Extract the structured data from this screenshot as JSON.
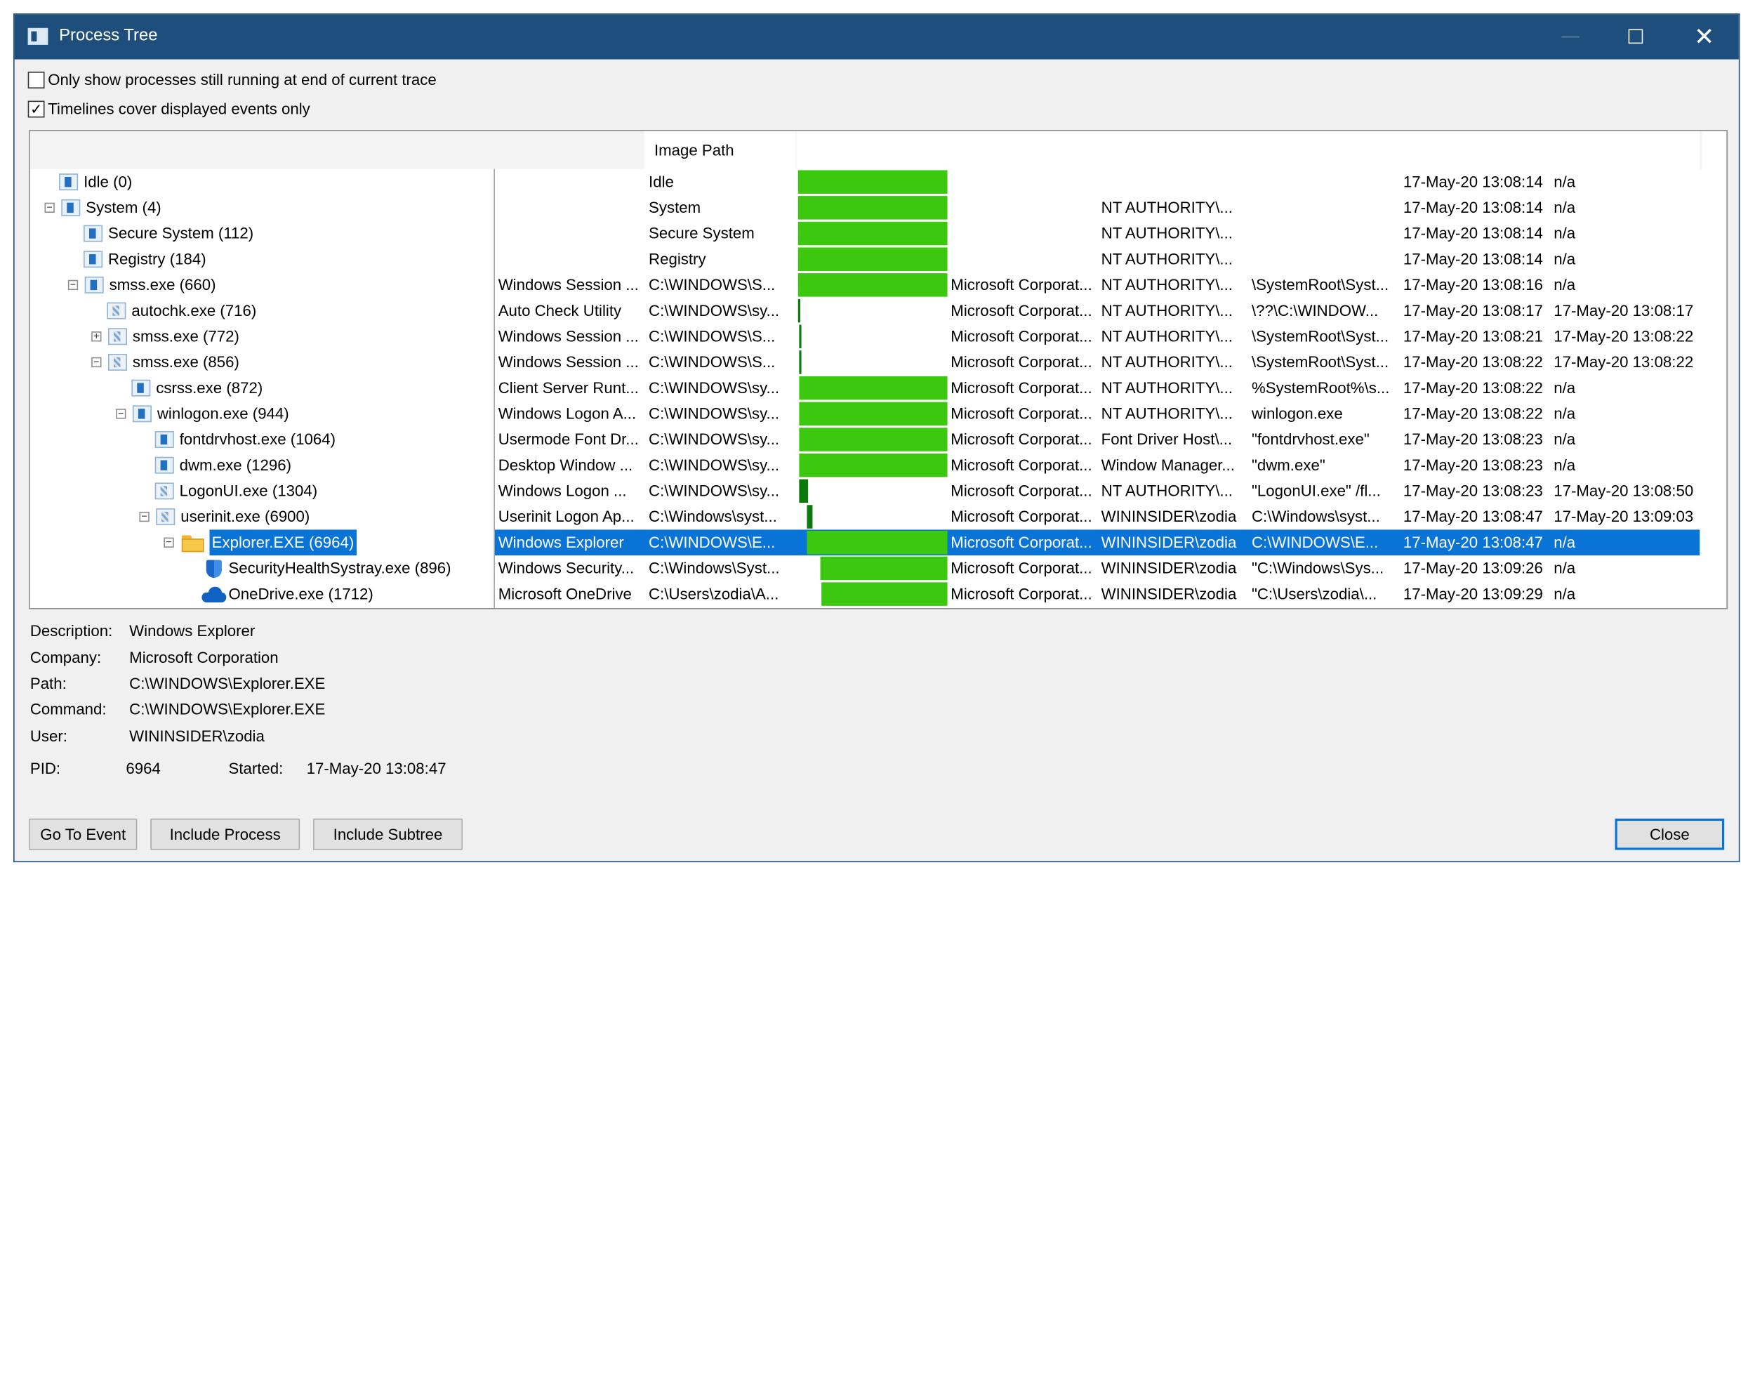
{
  "window": {
    "title": "Process Tree",
    "controls": {
      "minimize": "—",
      "close": "✕"
    }
  },
  "options": {
    "running_only": {
      "label": "Only show processes still running at end of current trace",
      "checked": false
    },
    "timelines_displayed_only": {
      "label": "Timelines cover displayed events only",
      "checked": true
    }
  },
  "columns": {
    "image_path": "Image Path"
  },
  "rows": [
    {
      "name": "Idle (0)",
      "desc": "",
      "path": "Idle",
      "company": "",
      "user": "",
      "cmd": "",
      "start": "17-May-20 13:08:14",
      "end": "n/a",
      "timeline": {
        "start": 0.0,
        "end": 1.0
      }
    },
    {
      "name": "System (4)",
      "desc": "",
      "path": "System",
      "company": "",
      "user": "NT AUTHORITY\\...",
      "cmd": "",
      "start": "17-May-20 13:08:14",
      "end": "n/a",
      "timeline": {
        "start": 0.0,
        "end": 1.0
      }
    },
    {
      "name": "Secure System (112)",
      "desc": "",
      "path": "Secure System",
      "company": "",
      "user": "NT AUTHORITY\\...",
      "cmd": "",
      "start": "17-May-20 13:08:14",
      "end": "n/a",
      "timeline": {
        "start": 0.0,
        "end": 1.0
      }
    },
    {
      "name": "Registry (184)",
      "desc": "",
      "path": "Registry",
      "company": "",
      "user": "NT AUTHORITY\\...",
      "cmd": "",
      "start": "17-May-20 13:08:14",
      "end": "n/a",
      "timeline": {
        "start": 0.0,
        "end": 1.0
      }
    },
    {
      "name": "smss.exe (660)",
      "desc": "Windows Session ...",
      "path": "C:\\WINDOWS\\S...",
      "company": "Microsoft Corporat...",
      "user": "NT AUTHORITY\\...",
      "cmd": "\\SystemRoot\\Syst...",
      "start": "17-May-20 13:08:16",
      "end": "n/a",
      "timeline": {
        "start": 0.0,
        "end": 1.0
      }
    },
    {
      "name": "autochk.exe (716)",
      "desc": "Auto Check Utility",
      "path": "C:\\WINDOWS\\sy...",
      "company": "Microsoft Corporat...",
      "user": "NT AUTHORITY\\...",
      "cmd": "\\??\\C:\\WINDOW...",
      "start": "17-May-20 13:08:17",
      "end": "17-May-20 13:08:17",
      "timeline": {
        "start": 0.0,
        "end": 0.01
      }
    },
    {
      "name": "smss.exe (772)",
      "desc": "Windows Session ...",
      "path": "C:\\WINDOWS\\S...",
      "company": "Microsoft Corporat...",
      "user": "NT AUTHORITY\\...",
      "cmd": "\\SystemRoot\\Syst...",
      "start": "17-May-20 13:08:21",
      "end": "17-May-20 13:08:22",
      "timeline": {
        "start": 0.01,
        "end": 0.02
      }
    },
    {
      "name": "smss.exe (856)",
      "desc": "Windows Session ...",
      "path": "C:\\WINDOWS\\S...",
      "company": "Microsoft Corporat...",
      "user": "NT AUTHORITY\\...",
      "cmd": "\\SystemRoot\\Syst...",
      "start": "17-May-20 13:08:22",
      "end": "17-May-20 13:08:22",
      "timeline": {
        "start": 0.01,
        "end": 0.02
      }
    },
    {
      "name": "csrss.exe (872)",
      "desc": "Client Server Runt...",
      "path": "C:\\WINDOWS\\sy...",
      "company": "Microsoft Corporat...",
      "user": "NT AUTHORITY\\...",
      "cmd": "%SystemRoot%\\s...",
      "start": "17-May-20 13:08:22",
      "end": "n/a",
      "timeline": {
        "start": 0.01,
        "end": 1.0
      }
    },
    {
      "name": "winlogon.exe (944)",
      "desc": "Windows Logon A...",
      "path": "C:\\WINDOWS\\sy...",
      "company": "Microsoft Corporat...",
      "user": "NT AUTHORITY\\...",
      "cmd": "winlogon.exe",
      "start": "17-May-20 13:08:22",
      "end": "n/a",
      "timeline": {
        "start": 0.01,
        "end": 1.0
      }
    },
    {
      "name": "fontdrvhost.exe (1064)",
      "desc": "Usermode Font Dr...",
      "path": "C:\\WINDOWS\\sy...",
      "company": "Microsoft Corporat...",
      "user": "Font Driver Host\\...",
      "cmd": "\"fontdrvhost.exe\"",
      "start": "17-May-20 13:08:23",
      "end": "n/a",
      "timeline": {
        "start": 0.01,
        "end": 1.0
      }
    },
    {
      "name": "dwm.exe (1296)",
      "desc": "Desktop Window ...",
      "path": "C:\\WINDOWS\\sy...",
      "company": "Microsoft Corporat...",
      "user": "Window Manager...",
      "cmd": "\"dwm.exe\"",
      "start": "17-May-20 13:08:23",
      "end": "n/a",
      "timeline": {
        "start": 0.01,
        "end": 1.0
      }
    },
    {
      "name": "LogonUI.exe (1304)",
      "desc": "Windows Logon ...",
      "path": "C:\\WINDOWS\\sy...",
      "company": "Microsoft Corporat...",
      "user": "NT AUTHORITY\\...",
      "cmd": "\"LogonUI.exe\" /fl...",
      "start": "17-May-20 13:08:23",
      "end": "17-May-20 13:08:50",
      "timeline": {
        "start": 0.01,
        "end": 0.07
      }
    },
    {
      "name": "userinit.exe (6900)",
      "desc": "Userinit Logon Ap...",
      "path": "C:\\Windows\\syst...",
      "company": "Microsoft Corporat...",
      "user": "WININSIDER\\zodia",
      "cmd": "C:\\Windows\\syst...",
      "start": "17-May-20 13:08:47",
      "end": "17-May-20 13:09:03",
      "timeline": {
        "start": 0.06,
        "end": 0.1
      }
    },
    {
      "name": "Explorer.EXE (6964)",
      "desc": "Windows Explorer",
      "path": "C:\\WINDOWS\\E...",
      "company": "Microsoft Corporat...",
      "user": "WININSIDER\\zodia",
      "cmd": "C:\\WINDOWS\\E...",
      "start": "17-May-20 13:08:47",
      "end": "n/a",
      "timeline": {
        "start": 0.06,
        "end": 1.0
      }
    },
    {
      "name": "SecurityHealthSystray.exe (896)",
      "desc": "Windows Security...",
      "path": "C:\\Windows\\Syst...",
      "company": "Microsoft Corporat...",
      "user": "WININSIDER\\zodia",
      "cmd": "\"C:\\Windows\\Sys...",
      "start": "17-May-20 13:09:26",
      "end": "n/a",
      "timeline": {
        "start": 0.15,
        "end": 1.0
      }
    },
    {
      "name": "OneDrive.exe (1712)",
      "desc": "Microsoft OneDrive",
      "path": "C:\\Users\\zodia\\A...",
      "company": "Microsoft Corporat...",
      "user": "WININSIDER\\zodia",
      "cmd": "\"C:\\Users\\zodia\\...",
      "start": "17-May-20 13:09:29",
      "end": "n/a",
      "timeline": {
        "start": 0.16,
        "end": 1.0
      }
    }
  ],
  "details": {
    "description_label": "Description:",
    "description": "Windows Explorer",
    "company_label": "Company:",
    "company": "Microsoft Corporation",
    "path_label": "Path:",
    "path": "C:\\WINDOWS\\Explorer.EXE",
    "command_label": "Command:",
    "command": "C:\\WINDOWS\\Explorer.EXE",
    "user_label": "User:",
    "user": "WININSIDER\\zodia",
    "pid_label": "PID:",
    "pid": "6964",
    "started_label": "Started:",
    "started": "17-May-20 13:08:47"
  },
  "buttons": {
    "go_to_event": "Go To Event",
    "include_process": "Include Process",
    "include_subtree": "Include Subtree",
    "close": "Close"
  },
  "colors": {
    "titlebar": "#1e4f7c",
    "selection": "#0a74d6",
    "timeline_running": "#3cc80e",
    "timeline_short": "#0a7a0a"
  }
}
